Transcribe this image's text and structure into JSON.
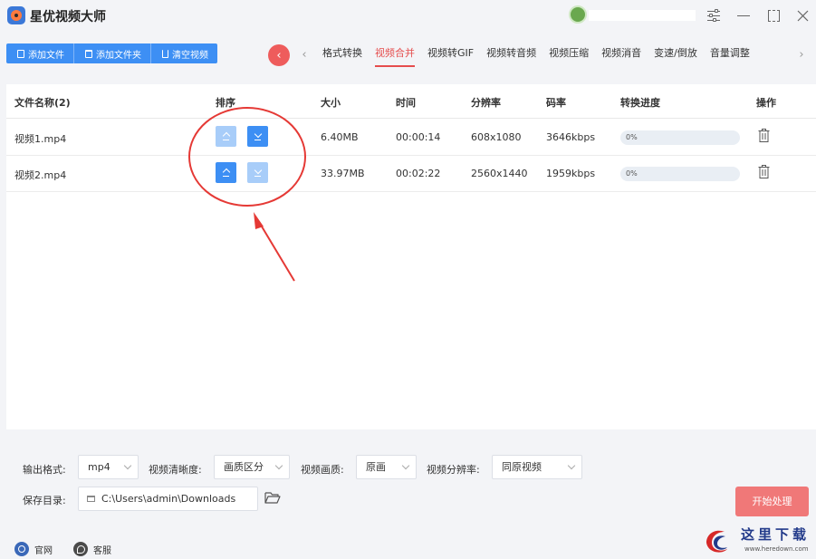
{
  "app": {
    "title": "星优视频大师"
  },
  "toolbar": {
    "add_file": "添加文件",
    "add_folder": "添加文件夹",
    "clear_videos": "清空视频"
  },
  "tabs": [
    "格式转换",
    "视频合并",
    "视频转GIF",
    "视频转音频",
    "视频压缩",
    "视频消音",
    "变速/倒放",
    "音量调整"
  ],
  "active_tab": "视频合并",
  "table": {
    "headers": {
      "name": "文件名称(2)",
      "sort": "排序",
      "size": "大小",
      "duration": "时间",
      "resolution": "分辨率",
      "bitrate": "码率",
      "progress": "转换进度",
      "actions": "操作"
    },
    "rows": [
      {
        "name": "视频1.mp4",
        "size": "6.40MB",
        "duration": "00:00:14",
        "resolution": "608x1080",
        "bitrate": "3646kbps",
        "progress": "0%",
        "progress_value": 0
      },
      {
        "name": "视频2.mp4",
        "size": "33.97MB",
        "duration": "00:02:22",
        "resolution": "2560x1440",
        "bitrate": "1959kbps",
        "progress": "0%",
        "progress_value": 0
      }
    ]
  },
  "settings": {
    "format_label": "输出格式:",
    "format_value": "mp4",
    "clarity_label": "视频清晰度:",
    "clarity_value": "画质区分",
    "quality_label": "视频画质:",
    "quality_value": "原画",
    "resolution_label": "视频分辨率:",
    "resolution_value": "同原视频",
    "save_label": "保存目录:",
    "save_path": "C:\\Users\\admin\\Downloads",
    "start_button": "开始处理"
  },
  "statusbar": {
    "website": "官网",
    "service": "客服"
  },
  "watermark": {
    "text": "这里下载",
    "url": "www.heredown.com"
  },
  "colors": {
    "accent": "#3d8ff4",
    "active_tab": "#e54d4d",
    "start_button": "#f07878",
    "annotation": "#e53935"
  }
}
